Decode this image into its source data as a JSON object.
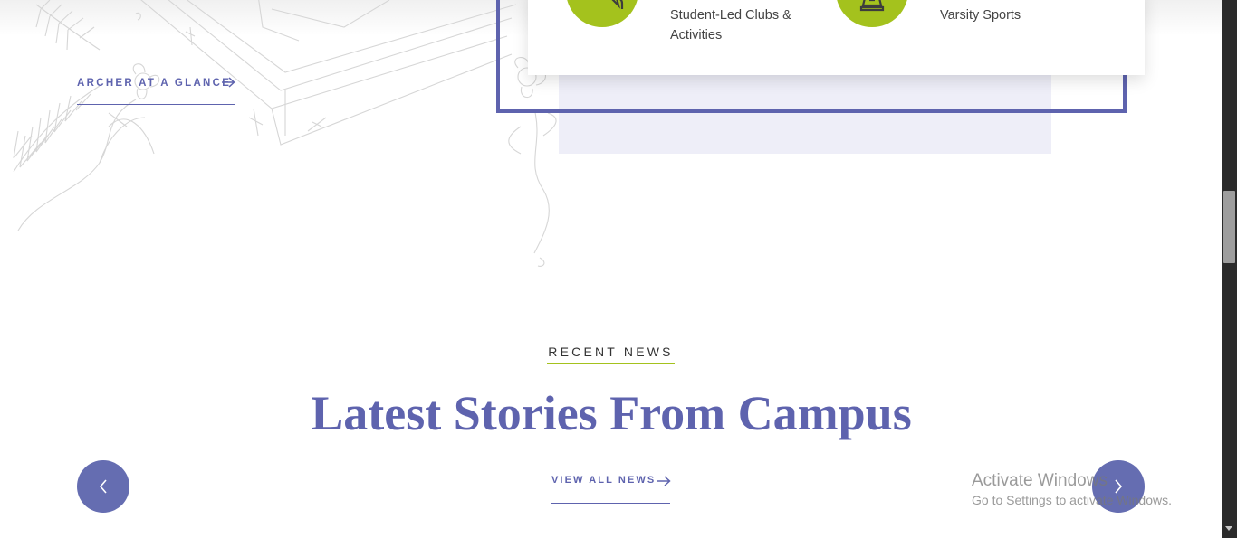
{
  "intro_section": {
    "glance_link_label": "ARCHER AT A GLANCE",
    "stats": [
      {
        "label_line1": "Student-Led Clubs &",
        "label_line2": "Activities",
        "icon": "speech-bubble-icon"
      },
      {
        "label_line1": "Varsity Sports",
        "label_line2": "",
        "icon": "trophy-icon"
      }
    ]
  },
  "news_section": {
    "eyebrow": "RECENT NEWS",
    "headline": "Latest Stories From Campus",
    "view_all_label": "VIEW ALL NEWS",
    "prev_icon": "chevron-left-icon",
    "next_icon": "chevron-right-icon"
  },
  "windows_watermark": {
    "title": "Activate Windows",
    "subtitle": "Go to Settings to activate Windows."
  },
  "colors": {
    "brand_purple": "#5e63ae",
    "carousel_button": "#656db1",
    "accent_green": "#a4c21d",
    "lavender_block": "#eeeef8",
    "body_text": "#444444"
  }
}
